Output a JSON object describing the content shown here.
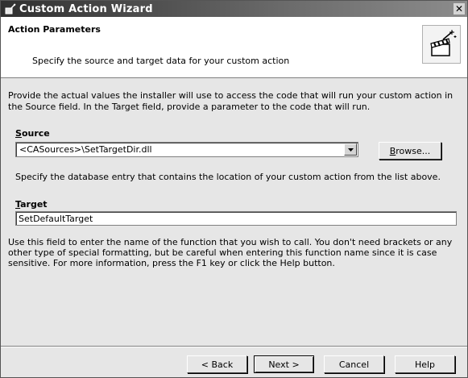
{
  "window": {
    "title": "Custom Action Wizard",
    "close_glyph": "✕"
  },
  "header": {
    "title": "Action Parameters",
    "subtitle": "Specify the source and target data for your custom action",
    "icon": "clapperboard-wand-icon"
  },
  "description": "Provide the actual values the installer will use to access the code that will run your custom action in the Source field.  In the Target field, provide a parameter to the code that will run.",
  "source": {
    "label_mnemonic": "S",
    "label_rest": "ource",
    "value": "<CASources>\\SetTargetDir.dll",
    "browse_mnemonic": "B",
    "browse_rest": "rowse...",
    "help": "Specify the database entry that contains the location of your custom action from the list above."
  },
  "target": {
    "label_mnemonic": "T",
    "label_rest": "arget",
    "value": "SetDefaultTarget",
    "help": "Use this field to enter the name of the function that you wish to call. You don't need brackets or any other type of special formatting, but be careful when entering this function name since it is case sensitive. For more information, press the F1 key or click the Help button."
  },
  "buttons": {
    "back": "< Back",
    "next": "Next >",
    "cancel": "Cancel",
    "help": "Help"
  }
}
